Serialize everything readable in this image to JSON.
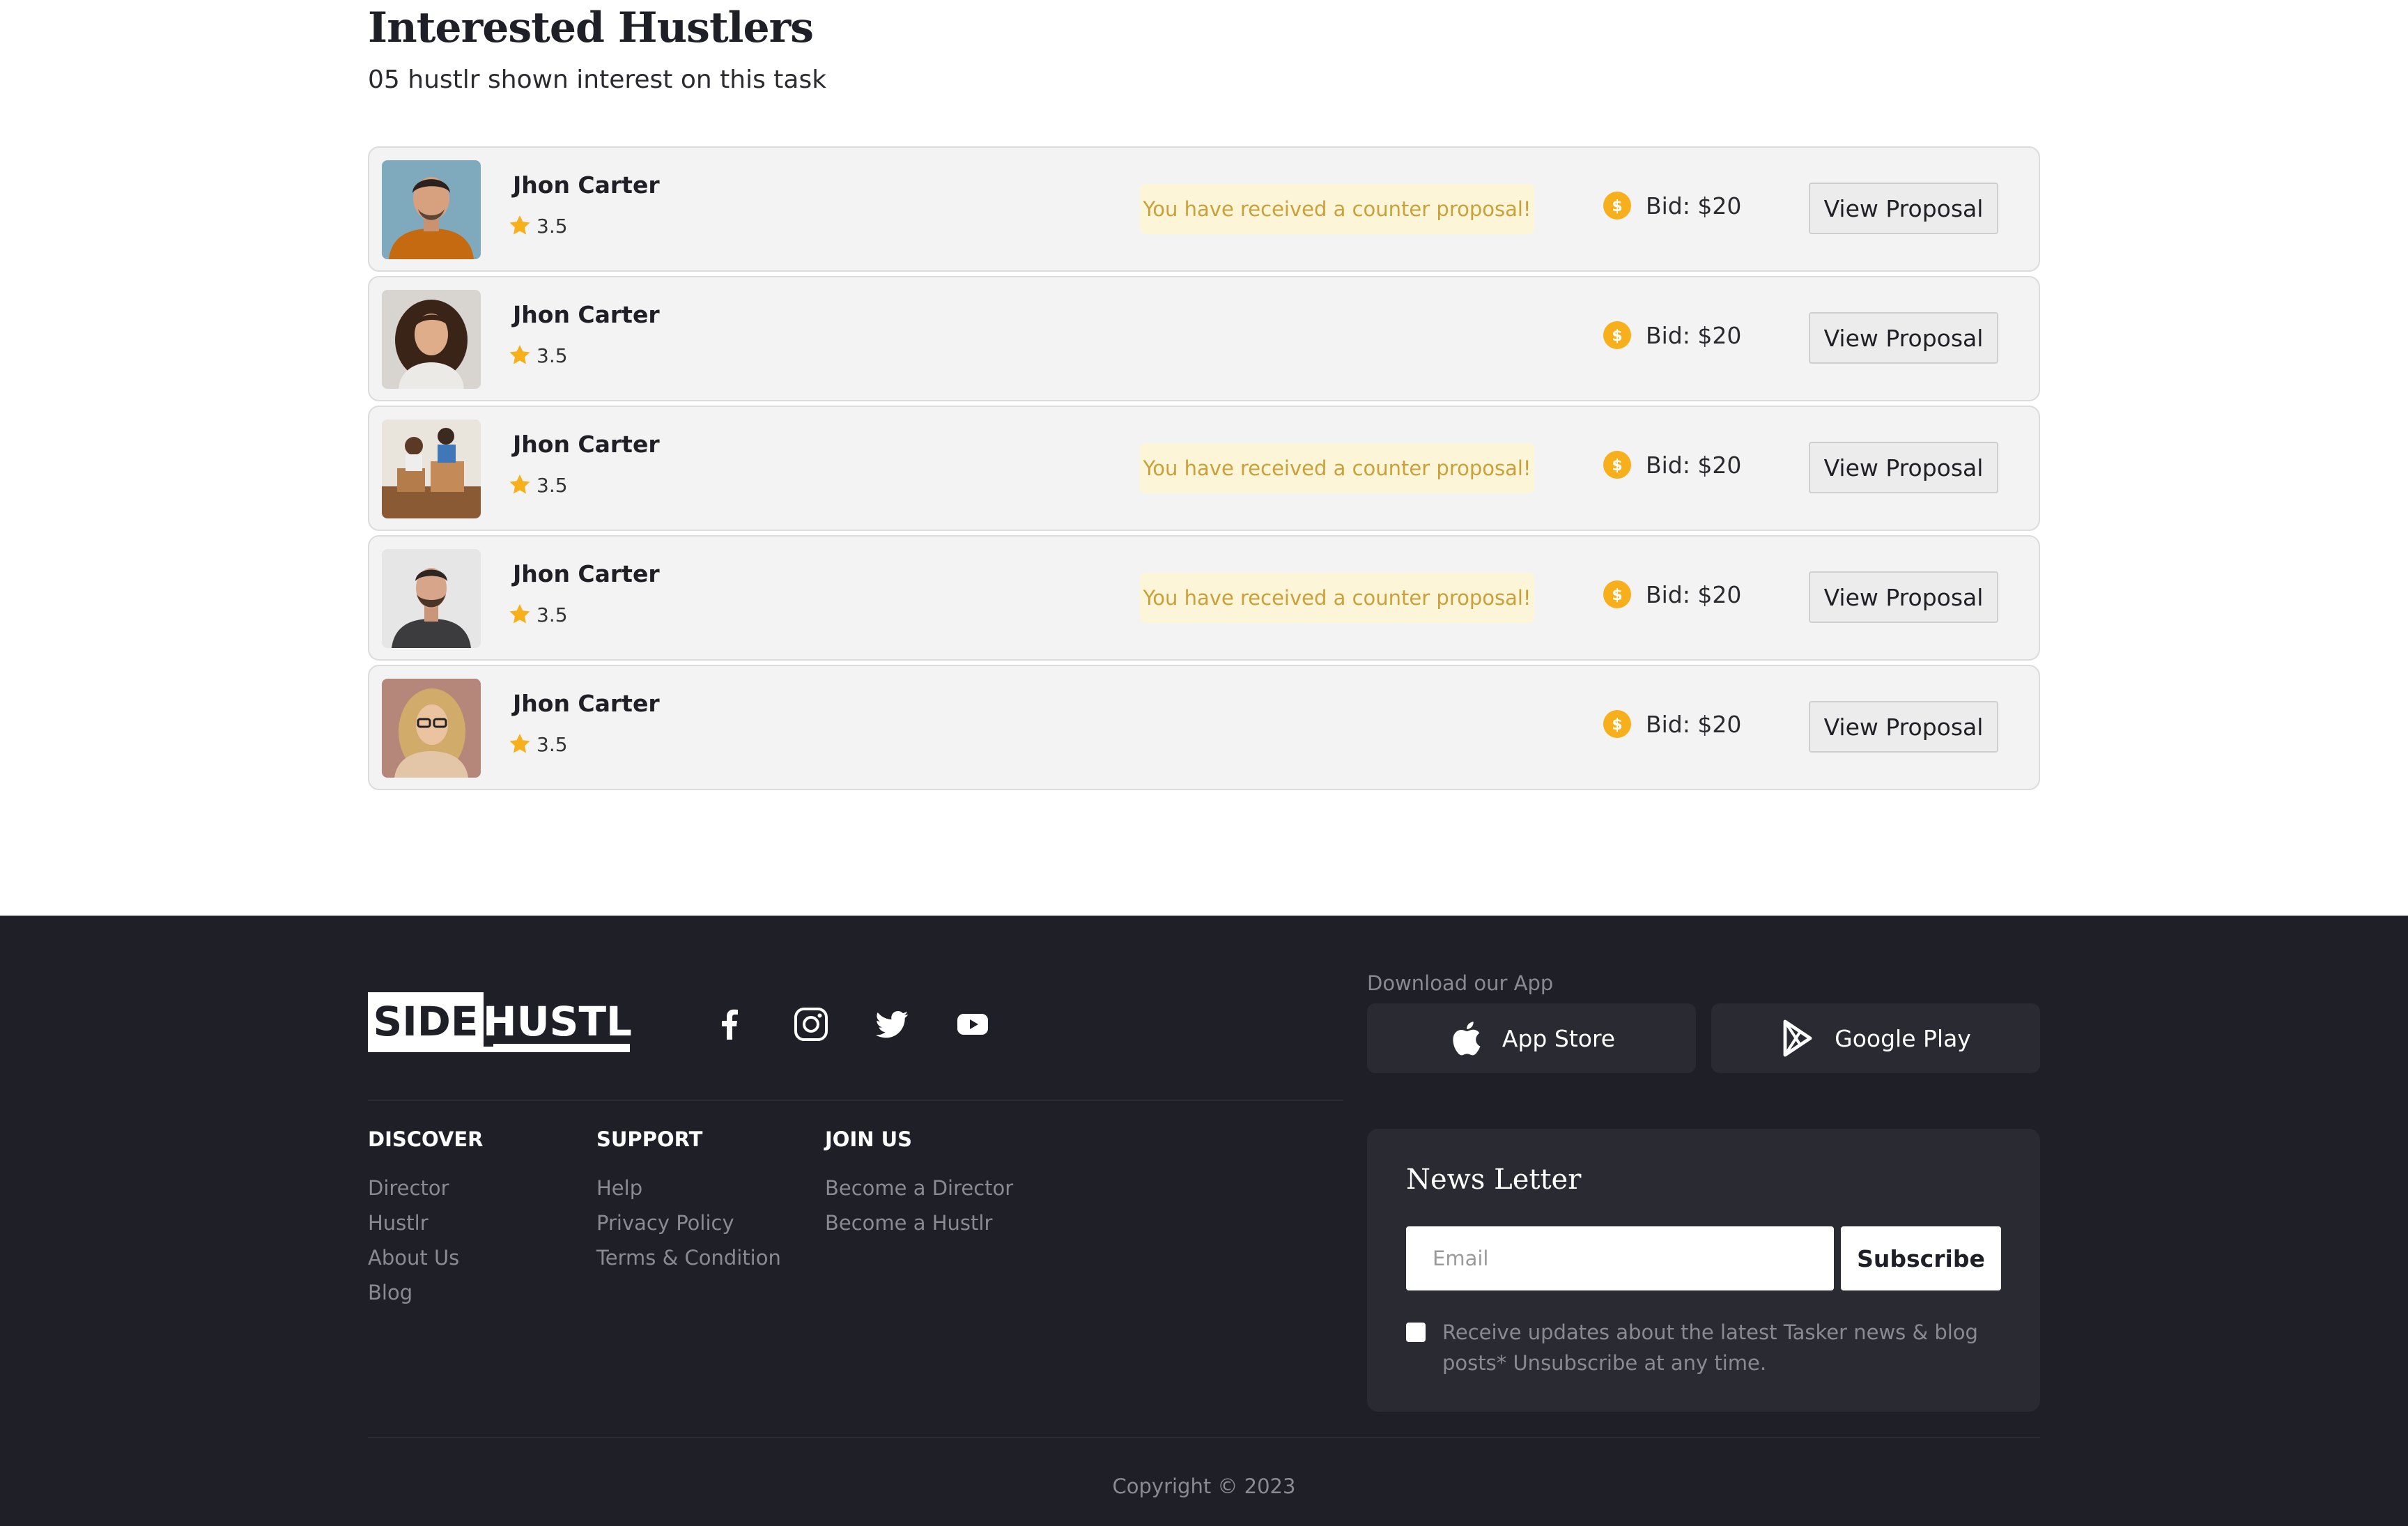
{
  "header": {
    "title": "Interested Hustlers",
    "subtitle": "05 hustlr shown interest on this task"
  },
  "proposals": [
    {
      "name": "Jhon Carter",
      "rating": "3.5",
      "counter_notice": "You have received a counter proposal!",
      "bid": "Bid: $20",
      "action": "View Proposal"
    },
    {
      "name": "Jhon Carter",
      "rating": "3.5",
      "counter_notice": "",
      "bid": "Bid: $20",
      "action": "View Proposal"
    },
    {
      "name": "Jhon Carter",
      "rating": "3.5",
      "counter_notice": "You have received a counter proposal!",
      "bid": "Bid: $20",
      "action": "View Proposal"
    },
    {
      "name": "Jhon Carter",
      "rating": "3.5",
      "counter_notice": "You have received a counter proposal!",
      "bid": "Bid: $20",
      "action": "View Proposal"
    },
    {
      "name": "Jhon Carter",
      "rating": "3.5",
      "counter_notice": "",
      "bid": "Bid: $20",
      "action": "View Proposal"
    }
  ],
  "footer": {
    "logo": {
      "part1": "SIDE",
      "part2": "HUSTL"
    },
    "social_icons": [
      "facebook-icon",
      "instagram-icon",
      "twitter-icon",
      "youtube-icon"
    ],
    "download_label": "Download our App",
    "app_store": "App Store",
    "google_play": "Google Play",
    "columns": [
      {
        "heading": "DISCOVER",
        "links": [
          "Director",
          "Hustlr",
          "About Us",
          "Blog"
        ]
      },
      {
        "heading": "SUPPORT",
        "links": [
          "Help",
          "Privacy Policy",
          "Terms & Condition"
        ]
      },
      {
        "heading": "JOIN US",
        "links": [
          "Become a Director",
          "Become a Hustlr"
        ]
      }
    ],
    "newsletter": {
      "title": "News Letter",
      "email_placeholder": "Email",
      "subscribe_label": "Subscribe",
      "consent_text": "Receive updates about the latest Tasker news & blog posts* Unsubscribe at any time."
    },
    "copyright": "Copyright © 2023"
  },
  "colors": {
    "accent": "#f7b01b",
    "footer_bg": "#1f2027",
    "counter_bg": "#fdf5d8",
    "counter_text": "#caa03a"
  }
}
